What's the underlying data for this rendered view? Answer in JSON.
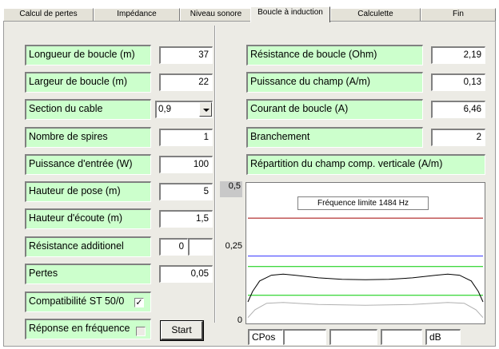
{
  "tabs": [
    {
      "label": "Calcul de pertes"
    },
    {
      "label": "Impédance"
    },
    {
      "label": "Niveau sonore"
    },
    {
      "label": "Boucle à induction"
    },
    {
      "label": "Calculette"
    },
    {
      "label": "Fin"
    }
  ],
  "left": {
    "longueur": {
      "label": "Longueur de boucle (m)",
      "value": "37"
    },
    "largeur": {
      "label": "Largeur de boucle (m)",
      "value": "22"
    },
    "section": {
      "label": "Section du cable",
      "value": "0,9"
    },
    "spires": {
      "label": "Nombre de spires",
      "value": "1"
    },
    "puissance_entree": {
      "label": "Puissance d'entrée (W)",
      "value": "100"
    },
    "hauteur_pose": {
      "label": "Hauteur de pose (m)",
      "value": "5"
    },
    "hauteur_ecoute": {
      "label": "Hauteur d'écoute (m)",
      "value": "1,5"
    },
    "resistance_add": {
      "label": "Résistance additionel",
      "value": "0",
      "value2": ""
    },
    "pertes": {
      "label": "Pertes",
      "value": "0,05"
    },
    "compat": {
      "label": "Compatibilité ST 50/0",
      "checked": true,
      "check_glyph": "✓"
    },
    "reponse": {
      "label": "Réponse en fréquence",
      "checked": false
    },
    "start_label": "Start"
  },
  "right": {
    "resistance": {
      "label": "Résistance de boucle (Ohm)",
      "value": "2,19"
    },
    "puissance_champ": {
      "label": "Puissance du champ (A/m)",
      "value": "0,13"
    },
    "courant": {
      "label": "Courant de boucle (A)",
      "value": "6,46"
    },
    "branchement": {
      "label": "Branchement",
      "value": "2"
    },
    "repartition_label": "Répartition du champ comp. verticale (A/m)"
  },
  "chart": {
    "y_ticks": [
      "0,5",
      "0,25",
      "0"
    ],
    "freq_label": "Fréquence limite  1484  Hz",
    "footer": {
      "cpos": "CPos",
      "f1": "",
      "f2": "",
      "f3": "",
      "unit": "dB"
    },
    "colors": {
      "red": "#a00000",
      "blue": "#3333ff",
      "green": "#00cc00",
      "black": "#000000",
      "gray": "#b0b0b0"
    }
  },
  "chart_data": {
    "type": "line",
    "title": "Répartition du champ comp. verticale (A/m)",
    "ylim": [
      0,
      0.5
    ],
    "y_ticks": [
      0,
      0.25,
      0.5
    ],
    "series": [
      {
        "name": "",
        "x": [
          0,
          1
        ],
        "values": [
          0.39,
          0.39
        ]
      },
      {
        "name": "",
        "x": [
          0,
          1
        ],
        "values": [
          0.245,
          0.245
        ]
      },
      {
        "name": "",
        "x": [
          0,
          1
        ],
        "values": [
          0.205,
          0.205
        ]
      },
      {
        "name": "",
        "x": [
          0,
          1
        ],
        "values": [
          0.095,
          0.095
        ]
      },
      {
        "name": "",
        "x": [
          0,
          0.02,
          0.05,
          0.1,
          0.15,
          0.2,
          0.3,
          0.4,
          0.5,
          0.6,
          0.7,
          0.8,
          0.85,
          0.9,
          0.95,
          0.98,
          1
        ],
        "values": [
          0.07,
          0.11,
          0.15,
          0.172,
          0.176,
          0.172,
          0.162,
          0.156,
          0.155,
          0.156,
          0.162,
          0.172,
          0.176,
          0.172,
          0.15,
          0.11,
          0.07
        ]
      },
      {
        "name": "",
        "x": [
          0,
          0.03,
          0.08,
          0.15,
          0.3,
          0.5,
          0.7,
          0.85,
          0.92,
          0.97,
          1
        ],
        "values": [
          0.01,
          0.04,
          0.065,
          0.068,
          0.06,
          0.057,
          0.06,
          0.068,
          0.065,
          0.04,
          0.01
        ]
      }
    ]
  }
}
